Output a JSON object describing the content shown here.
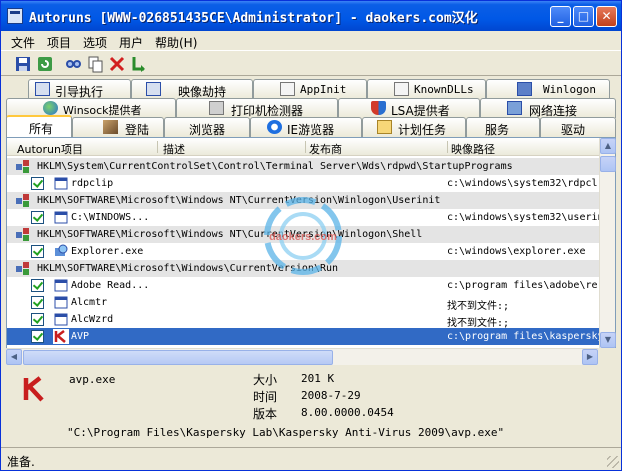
{
  "window": {
    "title": "Autoruns [WWW-026851435CE\\Administrator] - daokers.com汉化"
  },
  "menu": [
    "文件",
    "项目",
    "选项",
    "用户",
    "帮助(H)"
  ],
  "toolbar_icons": [
    "save-icon",
    "refresh-icon",
    "find-icon",
    "copy-icon",
    "delete-icon",
    "jump-icon"
  ],
  "tabs_row1": [
    "引导执行",
    "映像劫持",
    "AppInit",
    "KnownDLLs",
    "Winlogon"
  ],
  "tabs_row2": [
    "Winsock提供者",
    "打印机检测器",
    "LSA提供者",
    "网络连接"
  ],
  "tabs_row3": [
    "所有",
    "登陆",
    "浏览器",
    "IE游览器",
    "计划任务",
    "服务",
    "驱动"
  ],
  "columns": [
    "Autorun项目",
    "描述",
    "发布商",
    "映像路径"
  ],
  "rows": [
    {
      "type": "key",
      "text": "HKLM\\System\\CurrentControlSet\\Control\\Terminal Server\\Wds\\rdpwd\\StartupPrograms"
    },
    {
      "type": "entry",
      "name": "rdpclip",
      "path": "c:\\windows\\system32\\rdpcl"
    },
    {
      "type": "key",
      "text": "HKLM\\SOFTWARE\\Microsoft\\Windows NT\\CurrentVersion\\Winlogon\\Userinit"
    },
    {
      "type": "entry",
      "name": "C:\\WINDOWS...",
      "path": "c:\\windows\\system32\\userin"
    },
    {
      "type": "key",
      "text": "HKLM\\SOFTWARE\\Microsoft\\Windows NT\\CurrentVersion\\Winlogon\\Shell"
    },
    {
      "type": "entry",
      "name": "Explorer.exe",
      "path": "c:\\windows\\explorer.exe"
    },
    {
      "type": "key",
      "text": "HKLM\\SOFTWARE\\Microsoft\\Windows\\CurrentVersion\\Run"
    },
    {
      "type": "entry",
      "name": "Adobe Read...",
      "path": "c:\\program files\\adobe\\re"
    },
    {
      "type": "entry",
      "name": "Alcmtr",
      "path": "找不到文件:;"
    },
    {
      "type": "entry",
      "name": "AlcWzrd",
      "path": "找不到文件:;"
    },
    {
      "type": "entry",
      "name": "AVP",
      "path": "c:\\program files\\kaspersky",
      "selected": true
    }
  ],
  "details": {
    "filename": "avp.exe",
    "size_label": "大小",
    "size_value": "201 K",
    "time_label": "时间",
    "time_value": "2008-7-29",
    "version_label": "版本",
    "version_value": "8.00.0000.0454",
    "path": "\"C:\\Program Files\\Kaspersky Lab\\Kaspersky Anti-Virus 2009\\avp.exe\""
  },
  "status": "准备.",
  "watermark_text": "daokers.com",
  "colors": {
    "titlebar": "#0058e6",
    "selection": "#316ac5",
    "tab_highlight": "#ffc83c",
    "face": "#ece9d8"
  }
}
